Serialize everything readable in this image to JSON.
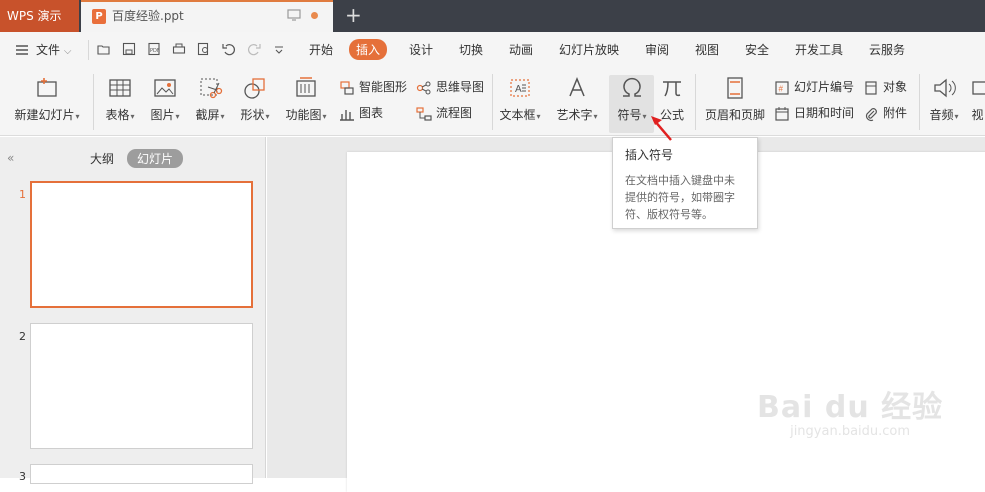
{
  "app": {
    "name": "WPS 演示"
  },
  "document": {
    "tab_title": "百度经验.ppt",
    "icon_letter": "P"
  },
  "menu": {
    "file": "文件",
    "tabs": [
      "开始",
      "插入",
      "设计",
      "切换",
      "动画",
      "幻灯片放映",
      "审阅",
      "视图",
      "安全",
      "开发工具",
      "云服务"
    ],
    "active_tab": "插入"
  },
  "ribbon": {
    "new_slide": "新建幻灯片",
    "table": "表格",
    "picture": "图片",
    "screenshot": "截屏",
    "shape": "形状",
    "function_chart": "功能图",
    "smart_art": "智能图形",
    "chart": "图表",
    "mind_map": "思维导图",
    "flowchart": "流程图",
    "textbox": "文本框",
    "word_art": "艺术字",
    "symbol": "符号",
    "formula": "公式",
    "header_footer": "页眉和页脚",
    "slide_number": "幻灯片编号",
    "date_time": "日期和时间",
    "object": "对象",
    "attachment": "附件",
    "audio": "音频",
    "video_partial": "视"
  },
  "panel": {
    "outline_tab": "大纲",
    "slides_tab": "幻灯片",
    "slide_numbers": [
      "1",
      "2",
      "3"
    ]
  },
  "tooltip": {
    "title": "插入符号",
    "description": "在文档中插入键盘中未提供的符号，如带圈字符、版权符号等。"
  },
  "watermark": {
    "line1": "Bai du 经验",
    "line2": "jingyan.baidu.com"
  },
  "colors": {
    "accent": "#e5703a",
    "titlebar": "#3c4048",
    "app_tab": "#c8522b"
  }
}
